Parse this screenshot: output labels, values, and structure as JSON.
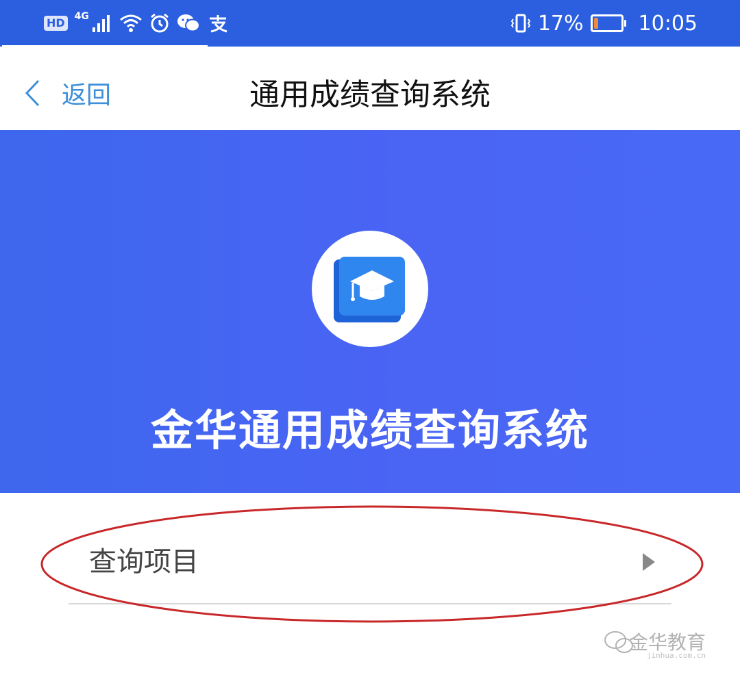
{
  "status_bar": {
    "hd_label": "HD",
    "network_label": "4G",
    "battery_percent_text": "17%",
    "battery_level": 0.17,
    "time": "10:05",
    "icons": [
      "signal-icon",
      "wifi-icon",
      "alarm-icon",
      "wechat-icon",
      "alipay-icon",
      "vibrate-icon",
      "battery-icon"
    ],
    "background_color": "#2b5fe0"
  },
  "nav": {
    "back_label": "返回",
    "title": "通用成绩查询系统",
    "back_color": "#3d8fd8"
  },
  "banner": {
    "title": "金华通用成绩查询系统",
    "logo_icon": "graduation-book-icon",
    "background_color": "#4a64f4"
  },
  "list": {
    "items": [
      {
        "label": "查询项目",
        "icon": "triangle-right-icon"
      }
    ]
  },
  "annotation": {
    "color": "#c8282a"
  },
  "watermark": {
    "text": "金华教育",
    "site": "jinhua.com.cn"
  }
}
